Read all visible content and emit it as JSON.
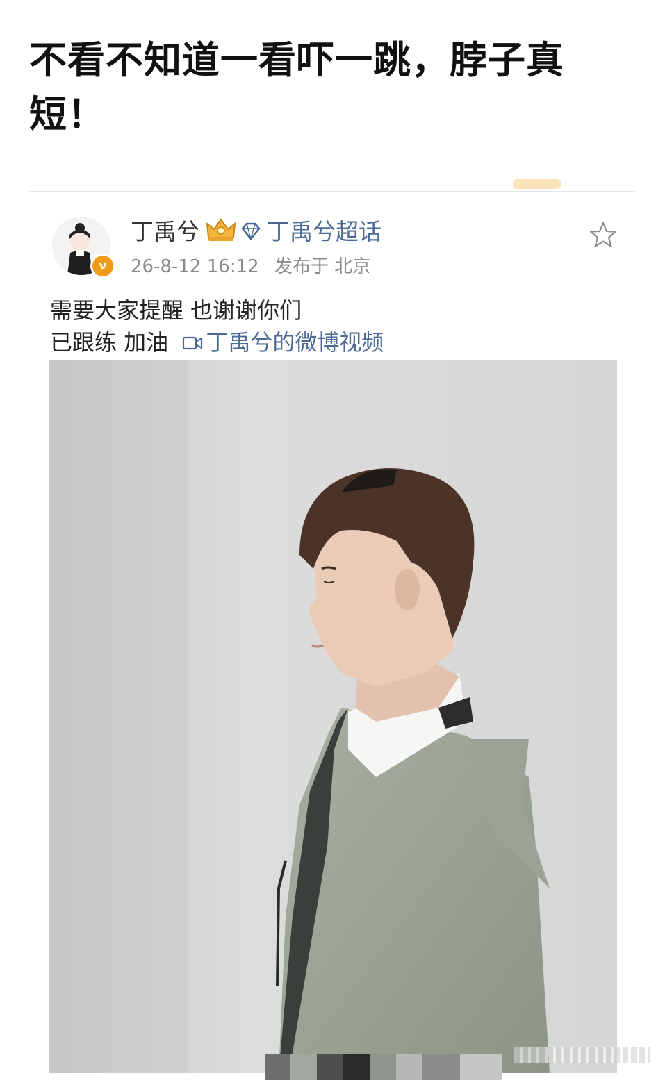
{
  "headline": "不看不知道一看吓一跳，脖子真短！",
  "post": {
    "username": "丁禹兮",
    "topic_link": "丁禹兮超话",
    "timestamp": "26-8-12 16:12",
    "location": "发布于 北京",
    "text_line1": "需要大家提醒 也谢谢你们",
    "text_line2": "已跟练 加油",
    "video_link": "丁禹兮的微博视频",
    "verify_badge": "v"
  },
  "icons": {
    "crown": "crown-icon",
    "diamond": "diamond-icon",
    "star": "star-icon",
    "video": "video-camera-icon"
  },
  "colors": {
    "link": "#4c6a96",
    "badge": "#f09a1a",
    "jacket": "#9ba596",
    "wall": "#d9d9d9"
  }
}
